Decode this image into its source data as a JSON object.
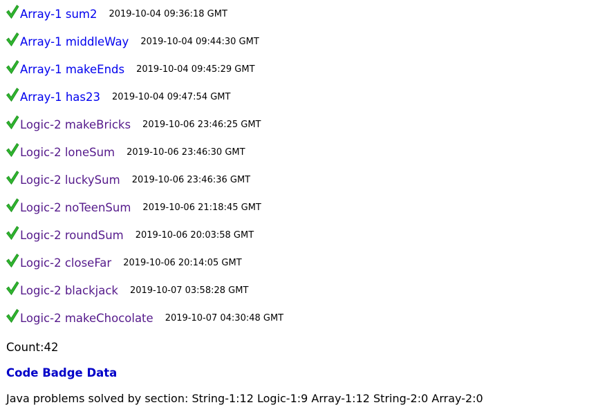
{
  "colors": {
    "check_green": "#2fb52f",
    "link_unvisited": "#0000ee",
    "link_visited": "#551a8b",
    "badge_link": "#0000c8"
  },
  "problems": [
    {
      "name": "Array-1 sum2",
      "time": "2019-10-04 09:36:18 GMT",
      "visited": false
    },
    {
      "name": "Array-1 middleWay",
      "time": "2019-10-04 09:44:30 GMT",
      "visited": false
    },
    {
      "name": "Array-1 makeEnds",
      "time": "2019-10-04 09:45:29 GMT",
      "visited": false
    },
    {
      "name": "Array-1 has23",
      "time": "2019-10-04 09:47:54 GMT",
      "visited": false
    },
    {
      "name": "Logic-2 makeBricks",
      "time": "2019-10-06 23:46:25 GMT",
      "visited": true
    },
    {
      "name": "Logic-2 loneSum",
      "time": "2019-10-06 23:46:30 GMT",
      "visited": true
    },
    {
      "name": "Logic-2 luckySum",
      "time": "2019-10-06 23:46:36 GMT",
      "visited": true
    },
    {
      "name": "Logic-2 noTeenSum",
      "time": "2019-10-06 21:18:45 GMT",
      "visited": true
    },
    {
      "name": "Logic-2 roundSum",
      "time": "2019-10-06 20:03:58 GMT",
      "visited": true
    },
    {
      "name": "Logic-2 closeFar",
      "time": "2019-10-06 20:14:05 GMT",
      "visited": true
    },
    {
      "name": "Logic-2 blackjack",
      "time": "2019-10-07 03:58:28 GMT",
      "visited": true
    },
    {
      "name": "Logic-2 makeChocolate",
      "time": "2019-10-07 04:30:48 GMT",
      "visited": true
    }
  ],
  "count_text": "Count:42",
  "badge_link": "Code Badge Data",
  "summary": "Java problems solved by section: String-1:12 Logic-1:9 Array-1:12 String-2:0 Array-2:0"
}
